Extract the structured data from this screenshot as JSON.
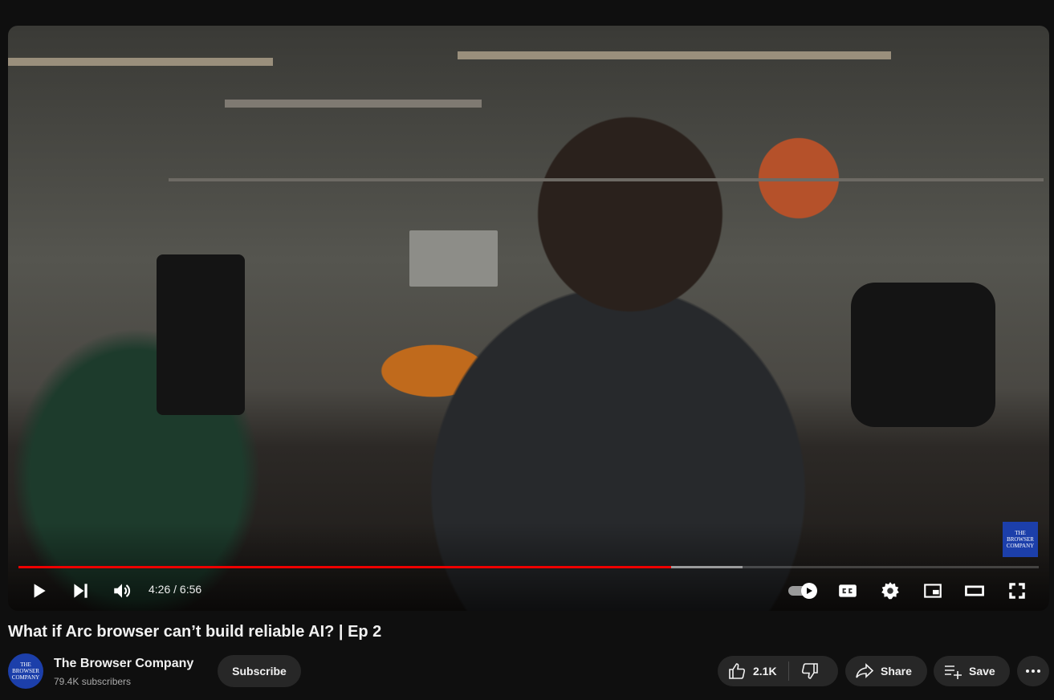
{
  "player": {
    "current_time": "4:26",
    "duration": "6:56",
    "time_separator": "/",
    "played_fraction": 0.64,
    "buffered_fraction": 0.71,
    "watermark_text": "THE BROWSER COMPANY",
    "icons": [
      "play-icon",
      "next-icon",
      "volume-icon",
      "autoplay-toggle-icon",
      "captions-icon",
      "settings-icon",
      "miniplayer-icon",
      "theater-icon",
      "fullscreen-icon"
    ]
  },
  "video": {
    "title": "What if Arc browser can’t build reliable AI? | Ep 2"
  },
  "channel": {
    "name": "The Browser Company",
    "subscribers": "79.4K subscribers",
    "avatar_text": "THE BROWSER COMPANY",
    "subscribe_label": "Subscribe"
  },
  "actions": {
    "likes": "2.1K",
    "share_label": "Share",
    "save_label": "Save"
  },
  "colors": {
    "background": "#0f0f0f",
    "progress_played": "#ee0000",
    "button_bg": "#272727",
    "brand_blue": "#1c3faa"
  }
}
